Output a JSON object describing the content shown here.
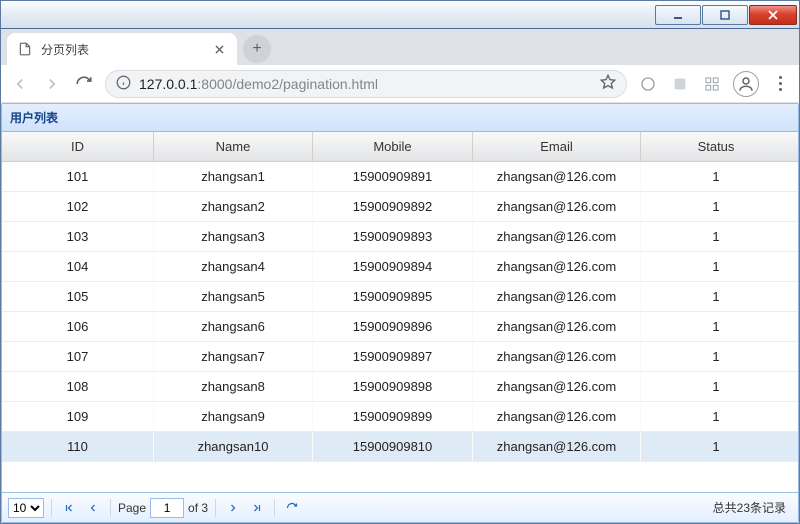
{
  "window": {
    "title": "分页列表"
  },
  "browser": {
    "tab_title": "分页列表",
    "url_host": "127.0.0.1",
    "url_port": ":8000",
    "url_path": "/demo2/pagination.html"
  },
  "panel": {
    "title": "用户列表",
    "columns": [
      "ID",
      "Name",
      "Mobile",
      "Email",
      "Status"
    ],
    "rows": [
      {
        "id": "101",
        "name": "zhangsan1",
        "mobile": "15900909891",
        "email": "zhangsan@126.com",
        "status": "1"
      },
      {
        "id": "102",
        "name": "zhangsan2",
        "mobile": "15900909892",
        "email": "zhangsan@126.com",
        "status": "1"
      },
      {
        "id": "103",
        "name": "zhangsan3",
        "mobile": "15900909893",
        "email": "zhangsan@126.com",
        "status": "1"
      },
      {
        "id": "104",
        "name": "zhangsan4",
        "mobile": "15900909894",
        "email": "zhangsan@126.com",
        "status": "1"
      },
      {
        "id": "105",
        "name": "zhangsan5",
        "mobile": "15900909895",
        "email": "zhangsan@126.com",
        "status": "1"
      },
      {
        "id": "106",
        "name": "zhangsan6",
        "mobile": "15900909896",
        "email": "zhangsan@126.com",
        "status": "1"
      },
      {
        "id": "107",
        "name": "zhangsan7",
        "mobile": "15900909897",
        "email": "zhangsan@126.com",
        "status": "1"
      },
      {
        "id": "108",
        "name": "zhangsan8",
        "mobile": "15900909898",
        "email": "zhangsan@126.com",
        "status": "1"
      },
      {
        "id": "109",
        "name": "zhangsan9",
        "mobile": "15900909899",
        "email": "zhangsan@126.com",
        "status": "1"
      },
      {
        "id": "110",
        "name": "zhangsan10",
        "mobile": "15900909810",
        "email": "zhangsan@126.com",
        "status": "1"
      }
    ]
  },
  "pager": {
    "page_size": "10",
    "page_label": "Page",
    "page": "1",
    "of_label": "of 3",
    "total_label": "总共23条记录"
  }
}
